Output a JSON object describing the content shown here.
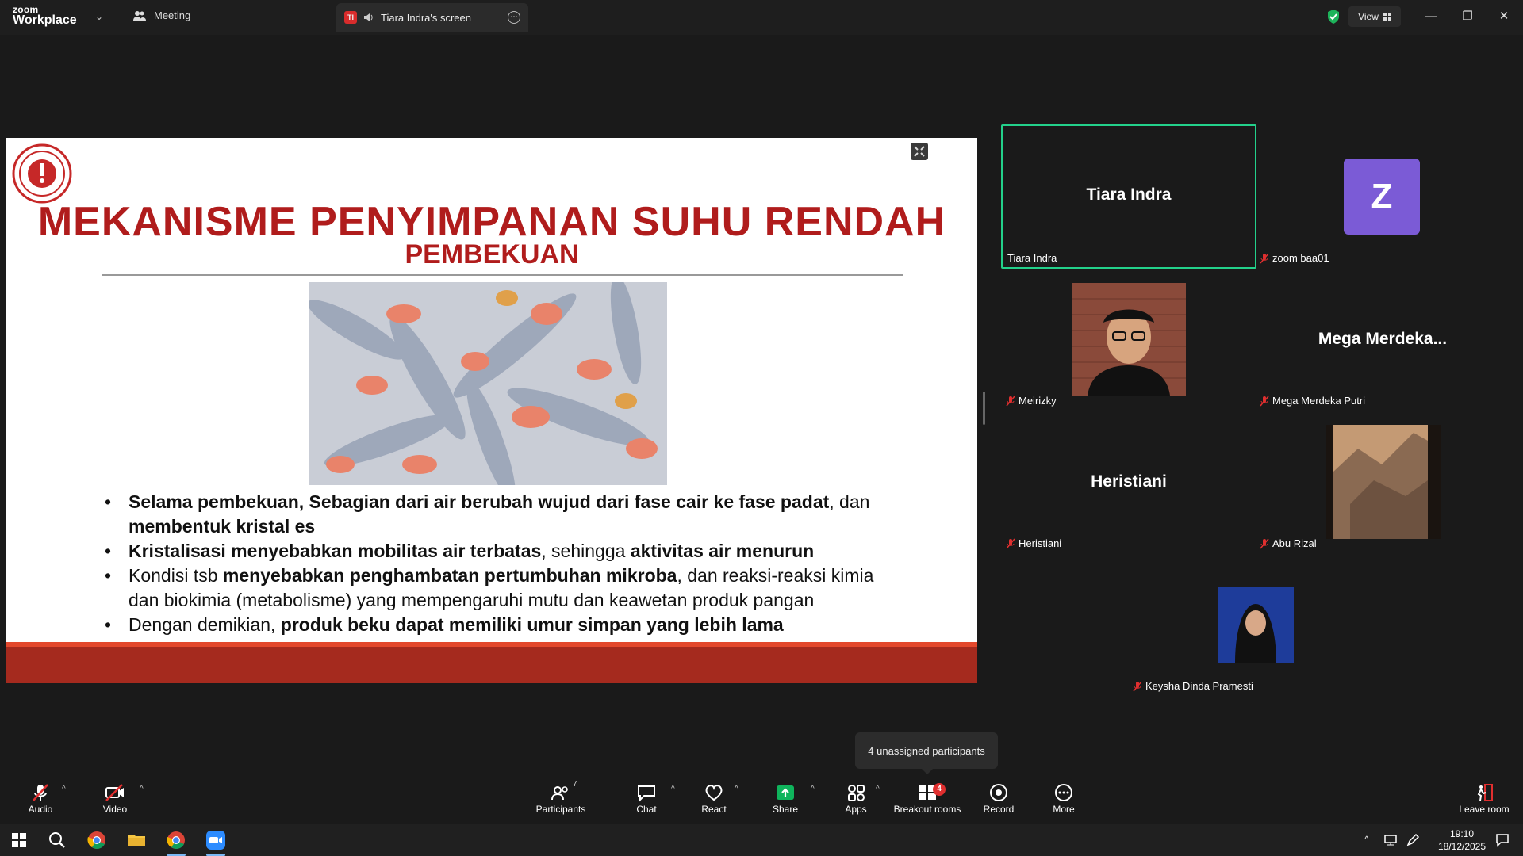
{
  "titlebar": {
    "logo_line1": "zoom",
    "logo_line2": "Workplace",
    "meeting_tab": "Meeting",
    "share_tab_badge": "TI",
    "share_tab": "Tiara Indra's screen",
    "view_label": "View"
  },
  "slide": {
    "title": "MEKANISME PENYIMPANAN SUHU RENDAH",
    "subtitle": "PEMBEKUAN",
    "stamp_text": "IMPORTANT",
    "bullets": [
      {
        "parts": [
          [
            "b",
            "Selama pembekuan, Sebagian dari air berubah wujud dari fase cair ke fase padat"
          ],
          [
            "n",
            ", dan "
          ],
          [
            "b",
            "membentuk kristal es"
          ]
        ]
      },
      {
        "parts": [
          [
            "b",
            "Kristalisasi menyebabkan mobilitas air terbatas"
          ],
          [
            "n",
            ", sehingga "
          ],
          [
            "b",
            "aktivitas air menurun"
          ]
        ]
      },
      {
        "parts": [
          [
            "n",
            "Kondisi tsb "
          ],
          [
            "b",
            "menyebabkan penghambatan pertumbuhan mikroba"
          ],
          [
            "n",
            ", dan reaksi-reaksi kimia dan biokimia (metabolisme) yang mempengaruhi mutu dan keawetan produk pangan"
          ]
        ]
      },
      {
        "parts": [
          [
            "n",
            "Dengan demikian, "
          ],
          [
            "b",
            "produk beku dapat memiliki umur simpan yang lebih lama"
          ]
        ]
      }
    ]
  },
  "participants": {
    "tiara_big": "Tiara Indra",
    "tiara_label": "Tiara Indra",
    "zoom_avatar_letter": "Z",
    "zoom_label": "zoom baa01",
    "meirizky_label": "Meirizky",
    "mega_big": "Mega Merdeka...",
    "mega_label": "Mega Merdeka Putri",
    "heristiani_big": "Heristiani",
    "heristiani_label": "Heristiani",
    "abu_label": "Abu Rizal",
    "keysha_label": "Keysha Dinda Pramesti"
  },
  "tooltip": "4 unassigned participants",
  "toolbar": {
    "audio": "Audio",
    "video": "Video",
    "participants": "Participants",
    "participants_count": "7",
    "chat": "Chat",
    "react": "React",
    "share": "Share",
    "apps": "Apps",
    "breakout": "Breakout rooms",
    "breakout_badge": "4",
    "record": "Record",
    "more": "More",
    "leave": "Leave room"
  },
  "taskbar": {
    "time": "19:10",
    "date": "18/12/2025"
  },
  "colors": {
    "slide_title": "#b01c1c",
    "active_speaker": "#23d18b",
    "share_green": "#0fb45c",
    "mic_off_red": "#e02f2f",
    "avatar_purple": "#7b5bd6"
  }
}
